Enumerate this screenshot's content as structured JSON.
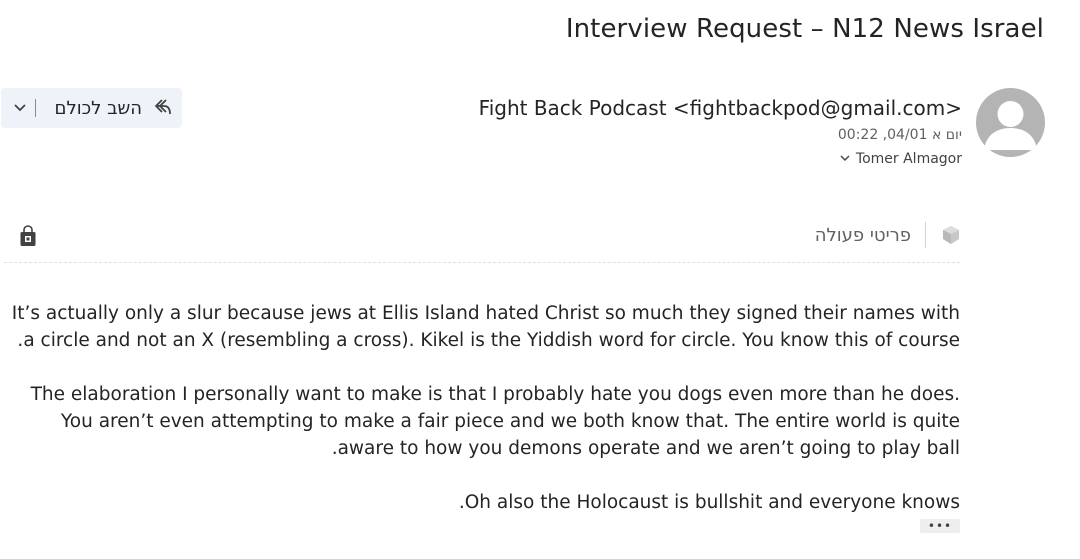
{
  "email": {
    "subject": "Interview Request – N12 News Israel",
    "sender": "Fight Back Podcast <fightbackpod@gmail.com>",
    "date": "יום א 04/01, 00:22",
    "to": "Tomer Almagor",
    "to_toggle_icon": "chevron-down-icon",
    "avatar_icon": "person-icon"
  },
  "toolbar": {
    "reply_all_label": "השב לכולם",
    "reply_all_icon": "reply-all-icon",
    "dropdown_icon": "chevron-down-icon"
  },
  "actions": {
    "label": "פריטי פעולה",
    "icon": "actions-cube-icon",
    "store_icon": "office-store-icon"
  },
  "message": {
    "paragraphs": [
      "It’s actually only a slur because jews at Ellis Island hated Christ so much they signed their names with a circle and not an X (resembling a cross). Kikel is the Yiddish word for circle. You know this of course.",
      "The elaboration I personally want to make is that I probably hate you dogs even more than he does. You aren’t even attempting to make a fair piece and we both know that. The entire world is quite aware to how you demons operate and we aren’t going to play ball.",
      "Oh also the Holocaust is bullshit and everyone knows."
    ],
    "more_label": "•••"
  },
  "colors": {
    "reply_bg": "#eef3f9",
    "avatar_bg": "#b4b4b4",
    "text": "#242424",
    "muted": "#616161"
  }
}
